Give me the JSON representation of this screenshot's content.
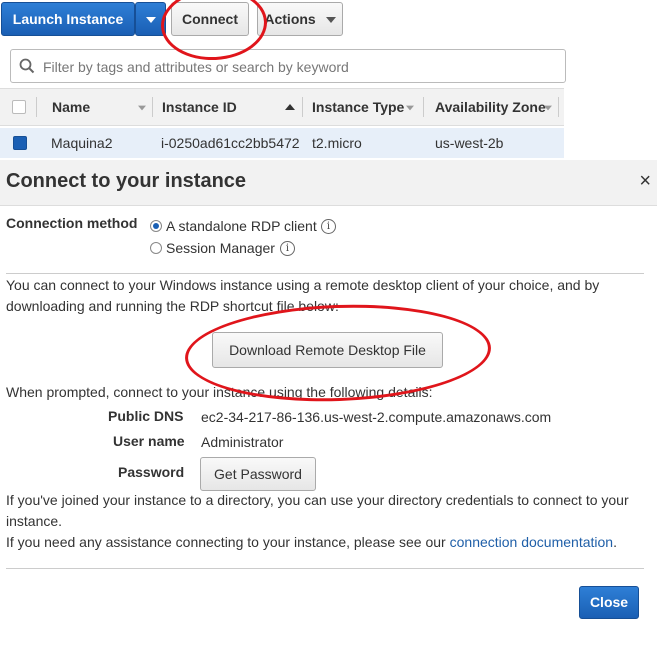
{
  "toolbar": {
    "launch_label": "Launch Instance",
    "connect_label": "Connect",
    "actions_label": "Actions"
  },
  "search": {
    "placeholder": "Filter by tags and attributes or search by keyword"
  },
  "table": {
    "columns": [
      "Name",
      "Instance ID",
      "Instance Type",
      "Availability Zone"
    ],
    "rows": [
      {
        "name": "Maquina2",
        "instance_id": "i-0250ad61cc2bb5472",
        "instance_type": "t2.micro",
        "zone": "us-west-2b"
      }
    ]
  },
  "modal": {
    "title": "Connect to your instance",
    "close_symbol": "×",
    "connection_method_label": "Connection method",
    "methods": [
      {
        "label": "A standalone RDP client",
        "selected": true
      },
      {
        "label": "Session Manager",
        "selected": false
      }
    ],
    "intro_text": "You can connect to your Windows instance using a remote desktop client of your choice, and by downloading and running the RDP shortcut file below:",
    "download_label": "Download Remote Desktop File",
    "prompt_text": "When prompted, connect to your instance using the following details:",
    "details": {
      "dns_label": "Public DNS",
      "dns_value": "ec2-34-217-86-136.us-west-2.compute.amazonaws.com",
      "user_label": "User name",
      "user_value": "Administrator",
      "password_label": "Password",
      "get_password_label": "Get Password"
    },
    "directory_text": "If you've joined your instance to a directory, you can use your directory credentials to connect to your instance.",
    "assist_text": "If you need any assistance connecting to your instance, please see our",
    "assist_link": "connection documentation",
    "assist_end": ".",
    "close_label": "Close"
  },
  "colors": {
    "primary": "#1a5fb4",
    "annotation": "#e0151b",
    "selected_row": "#e7eff9"
  }
}
